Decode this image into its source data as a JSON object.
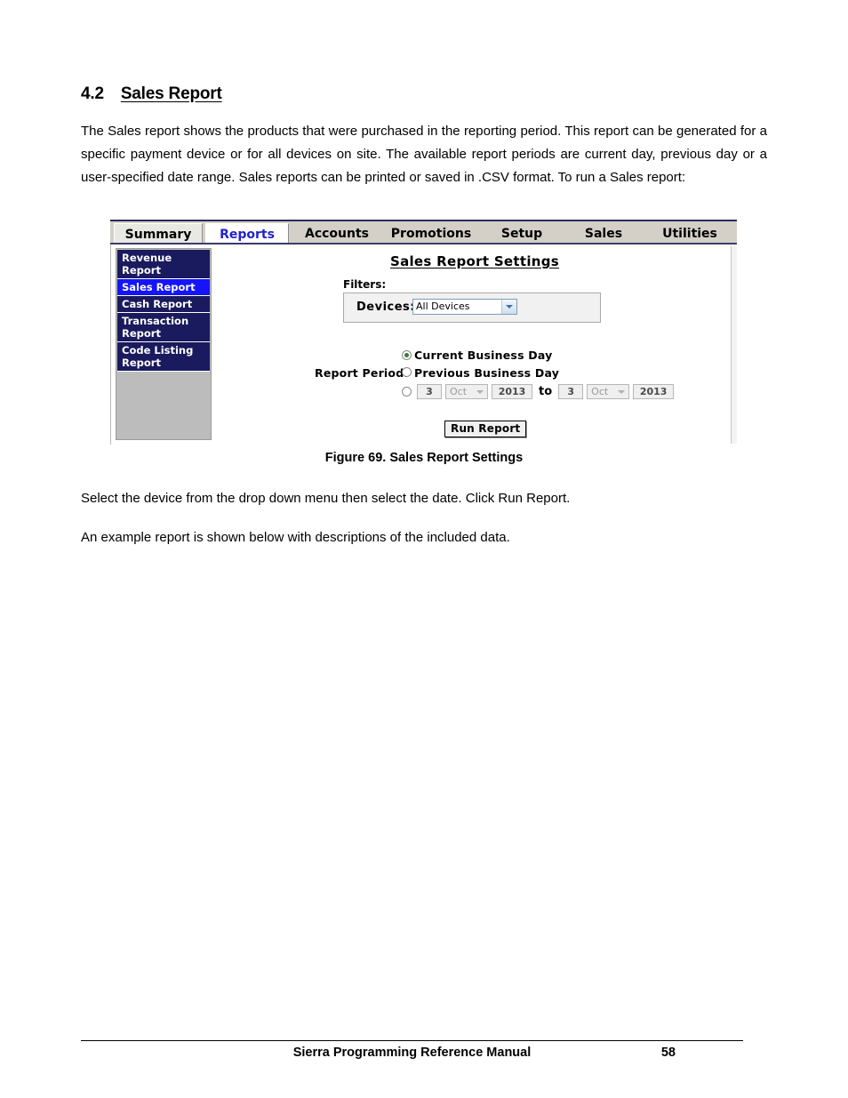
{
  "section": {
    "number": "4.2",
    "title": "Sales Report"
  },
  "paragraphs": {
    "intro": "The Sales report shows the products that were purchased in the reporting period. This report can be generated for a specific payment device or for all devices on site. The available report periods are current day, previous day or a user-specified date range. Sales reports can be printed or saved in .CSV format. To run a Sales report:",
    "after_figure_1": "Select the device from the drop down menu then select the date. Click Run Report.",
    "after_figure_2": "An example report is shown below with descriptions of the included data."
  },
  "figure": {
    "caption": "Figure 69. Sales Report Settings",
    "app": {
      "tabs": [
        {
          "label": "Summary",
          "active": false
        },
        {
          "label": "Reports",
          "active": true
        },
        {
          "label": "Accounts",
          "active": false
        },
        {
          "label": "Promotions",
          "active": false
        },
        {
          "label": "Setup",
          "active": false
        },
        {
          "label": "Sales",
          "active": false
        },
        {
          "label": "Utilities",
          "active": false
        }
      ],
      "sidebar": {
        "items": [
          {
            "label": "Revenue Report",
            "selected": false
          },
          {
            "label": "Sales Report",
            "selected": true
          },
          {
            "label": "Cash Report",
            "selected": false
          },
          {
            "label": "Transaction Report",
            "selected": false
          },
          {
            "label": "Code Listing Report",
            "selected": false
          }
        ]
      },
      "panel": {
        "title": "Sales Report Settings",
        "filters_label": "Filters:",
        "devices_label": "Devices:",
        "devices_value": "All Devices",
        "report_period_label": "Report Period:",
        "option_current": "Current Business Day",
        "option_previous": "Previous Business Day",
        "date_range": {
          "from_day": "3",
          "from_month": "Oct",
          "from_year": "2013",
          "to_word": "to",
          "to_day": "3",
          "to_month": "Oct",
          "to_year": "2013"
        },
        "run_button": "Run Report"
      },
      "colors": {
        "tab_active_text": "#2222cc",
        "sidebar_bg": "#1a1a5e",
        "sidebar_selected_bg": "#1414ff",
        "radio_dot": "#3a7a3a"
      }
    }
  },
  "footer": {
    "title": "Sierra Programming Reference Manual",
    "page": "58"
  }
}
